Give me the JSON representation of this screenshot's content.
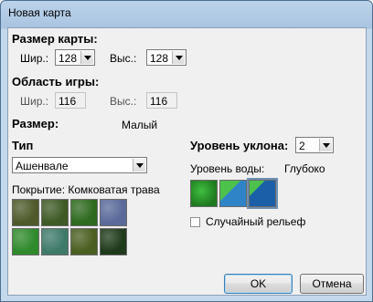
{
  "window": {
    "title": "Новая карта"
  },
  "map_size": {
    "heading": "Размер карты:",
    "width_label": "Шир.:",
    "width_value": "128",
    "height_label": "Выс.:",
    "height_value": "128"
  },
  "play_area": {
    "heading": "Область игры:",
    "width_label": "Шир.:",
    "width_value": "116",
    "height_label": "Выс.:",
    "height_value": "116"
  },
  "size": {
    "label": "Размер:",
    "value": "Малый"
  },
  "type": {
    "label": "Тип",
    "selected": "Ашенвале"
  },
  "coverage": {
    "label": "Покрытие: Комковатая трава",
    "tiles": [
      {
        "color": "#4e5a2a"
      },
      {
        "color": "#3f5a25"
      },
      {
        "color": "#2e6a1f"
      },
      {
        "color": "#5a6a9a"
      },
      {
        "color": "#2f8a2c"
      },
      {
        "color": "#3e7a6a"
      },
      {
        "color": "#4a5f20"
      },
      {
        "color": "#1f3a1a"
      }
    ]
  },
  "slope": {
    "label": "Уровень уклона:",
    "value": "2"
  },
  "water": {
    "label": "Уровень воды:",
    "value": "Глубоко",
    "options": [
      {
        "name": "land-icon"
      },
      {
        "name": "shallow-water-icon"
      },
      {
        "name": "deep-water-icon"
      }
    ]
  },
  "random_relief": {
    "label": "Случайный рельеф",
    "checked": false
  },
  "buttons": {
    "ok": "OK",
    "cancel": "Отмена"
  }
}
